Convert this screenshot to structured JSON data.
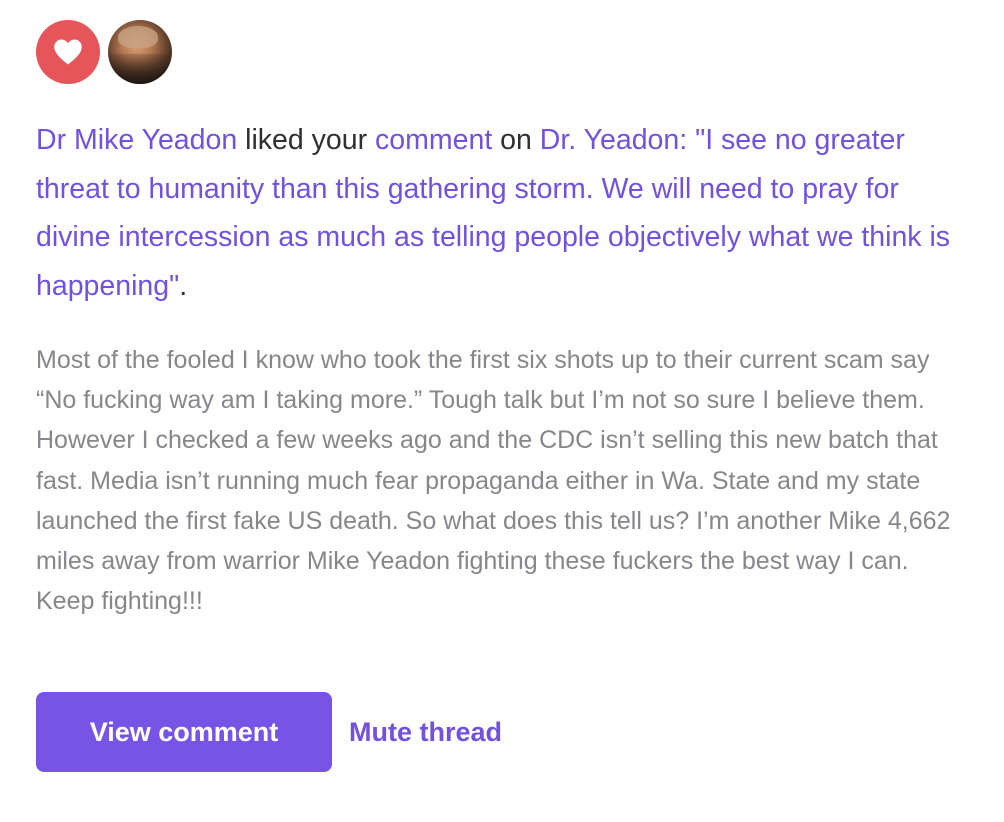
{
  "notification": {
    "icons": {
      "badge": "heart-icon",
      "badge_color": "#e5555a",
      "avatar": "user-avatar"
    },
    "headline": {
      "actor": "Dr Mike Yeadon",
      "verb": " liked your ",
      "object": "comment",
      "preposition": " on ",
      "post_title": "Dr. Yeadon: \"I see no greater threat to humanity than this gathering storm. We will need to pray for divine intercession as much as telling people objectively what we think is happening\"",
      "period": "."
    },
    "comment_text": "Most of the fooled I know who took the first six shots up to their current scam say “No fucking way am I taking more.” Tough talk but I’m not so sure I believe them. However I checked a few weeks ago and the CDC isn’t selling this new batch that fast. Media isn’t running much fear propaganda either in Wa. State and my state launched the first fake US death. So what does this tell us? I’m another Mike 4,662 miles away from warrior Mike Yeadon fighting these fuckers the best way I can. Keep fighting!!!",
    "actions": {
      "view_label": "View comment",
      "mute_label": "Mute thread"
    },
    "colors": {
      "accent": "#7251e0",
      "button": "#7754e5",
      "body_text": "#86868b"
    }
  }
}
